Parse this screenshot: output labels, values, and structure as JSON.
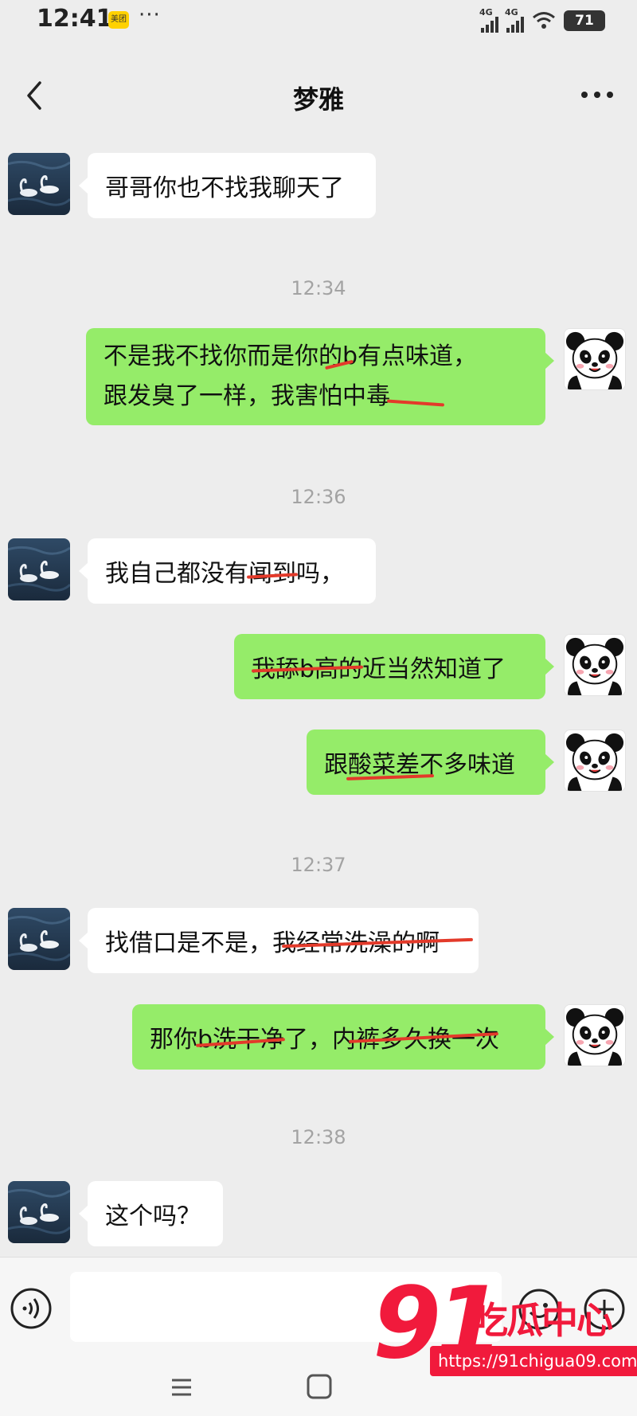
{
  "status_bar": {
    "time": "12:41",
    "app_badge": "美团",
    "more": "···",
    "signal_1": "4G",
    "signal_2": "4G",
    "battery": "71"
  },
  "header": {
    "title": "梦雅"
  },
  "timestamps": [
    "12:34",
    "12:36",
    "12:37",
    "12:38"
  ],
  "messages": [
    {
      "side": "in",
      "text": "哥哥你也不找我聊天了"
    },
    {
      "side": "out",
      "lines": [
        "不是我不找你而是你的b有点味道，",
        "跟发臭了一样，我害怕中毒"
      ]
    },
    {
      "side": "in",
      "text": "我自己都没有闻到吗，"
    },
    {
      "side": "out",
      "text": "我舔b高的近当然知道了"
    },
    {
      "side": "out",
      "text": "跟酸菜差不多味道"
    },
    {
      "side": "in",
      "text": "找借口是不是，我经常洗澡的啊"
    },
    {
      "side": "out",
      "text": "那你b洗干净了，内裤多久换一次"
    },
    {
      "side": "in",
      "text": "这个吗？"
    }
  ],
  "input": {
    "value": "",
    "placeholder": ""
  },
  "watermark": {
    "number": "91",
    "name": "吃瓜中心",
    "url": "https://91chigua09.com"
  },
  "icons": {
    "back": "chevron-left-icon",
    "more": "more-dots-icon",
    "voice": "voice-icon",
    "emoji": "emoji-icon",
    "plus": "plus-icon",
    "menu": "menu-icon",
    "home": "home-icon"
  },
  "colors": {
    "background": "#ededed",
    "incoming_bubble": "#ffffff",
    "outgoing_bubble": "#95ec69",
    "timestamp": "#a3a3a3",
    "censor_strike": "#e33a2a",
    "watermark": "#f11a3c"
  }
}
